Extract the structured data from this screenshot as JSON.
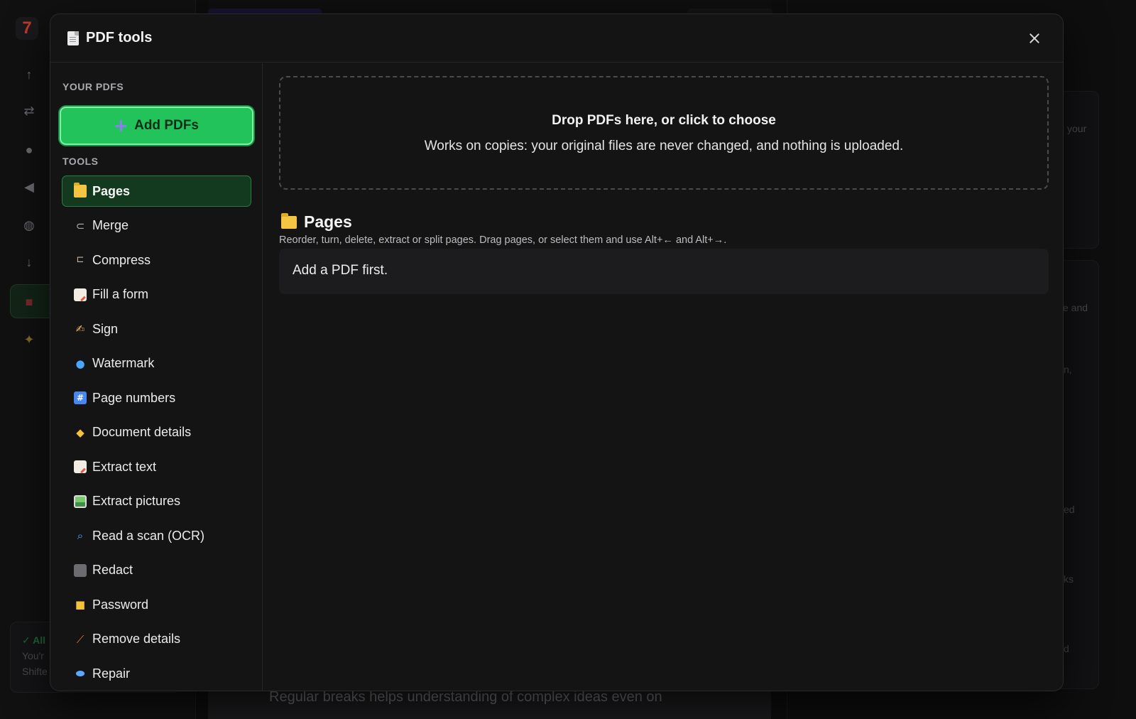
{
  "background": {
    "status_ok": "✓ All",
    "status_line1": "You'r",
    "status_line2": "Shifte",
    "bottom_text": "Regular breaks helps understanding of complex ideas even on",
    "right_text_1": "your",
    "right_text_2": "e and",
    "right_text_3": "n,",
    "right_text_4": "ed",
    "right_text_5": "ks",
    "right_text_6": "d"
  },
  "modal": {
    "title": "PDF tools",
    "title_icon": "page-facing-up-icon",
    "close_icon": "close-icon"
  },
  "left_panel": {
    "your_pdfs_label": "YOUR PDFS",
    "add_button_label": "Add PDFs",
    "tools_label": "TOOLS",
    "tools": [
      {
        "label": "Pages",
        "icon": "folder-icon",
        "active": true
      },
      {
        "label": "Merge",
        "icon": "paperclip-icon",
        "glyph": "📎"
      },
      {
        "label": "Compress",
        "icon": "clamp-icon",
        "glyph": "⊏"
      },
      {
        "label": "Fill a form",
        "icon": "memo-icon"
      },
      {
        "label": "Sign",
        "icon": "writing-hand-icon",
        "glyph": "✍"
      },
      {
        "label": "Watermark",
        "icon": "droplet-icon",
        "glyph": "💧"
      },
      {
        "label": "Page numbers",
        "icon": "hash-icon",
        "glyph": "#"
      },
      {
        "label": "Document details",
        "icon": "tag-icon",
        "glyph": "🏷"
      },
      {
        "label": "Extract text",
        "icon": "memo-icon"
      },
      {
        "label": "Extract pictures",
        "icon": "picture-icon"
      },
      {
        "label": "Read a scan (OCR)",
        "icon": "magnifier-icon",
        "glyph": "🔍"
      },
      {
        "label": "Redact",
        "icon": "black-square-icon"
      },
      {
        "label": "Password",
        "icon": "lock-icon",
        "glyph": "🔒"
      },
      {
        "label": "Remove details",
        "icon": "broom-icon",
        "glyph": "⟋"
      },
      {
        "label": "Repair",
        "icon": "pill-icon",
        "glyph": "⬬"
      }
    ]
  },
  "main": {
    "drop_title": "Drop PDFs here, or click to choose",
    "drop_subtitle": "Works on copies: your original files are never changed, and nothing is uploaded.",
    "section_title": "Pages",
    "section_description": "Reorder, turn, delete, extract or split pages. Drag pages, or select them and use Alt+← and Alt+→.",
    "empty_message": "Add a PDF first."
  },
  "colors": {
    "accent_green": "#22c35a",
    "active_item_bg": "#133a1f",
    "modal_bg": "#141415"
  }
}
